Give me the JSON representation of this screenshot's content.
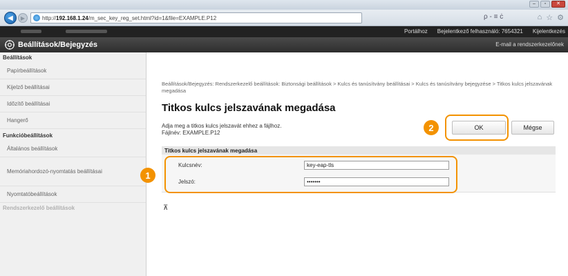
{
  "browser": {
    "address_prefix": "http://",
    "address_host": "192.168.1.24",
    "address_path": "/m_sec_key_reg_set.html?id=1&file=EXAMPLE.P12",
    "search_glyph": "ρ - ≡ ċ",
    "window_controls": [
      "–",
      "▫",
      "✕"
    ]
  },
  "topbar": {
    "links": [
      "Portálhoz",
      "Bejelentkező felhasználó: 7654321",
      "Kijelentkezés"
    ]
  },
  "header": {
    "title": "Beállítások/Bejegyzés",
    "mail_link": "E-mail a rendszerkezelőnek"
  },
  "sidebar": {
    "sections": [
      {
        "heading": "Beállítások",
        "items": [
          "Papírbeállítások",
          "Kijelző beállításai",
          "Időzítő beállításai",
          "Hangerő"
        ]
      },
      {
        "heading": "Funkcióbeállítások",
        "items": [
          "Általános beállítások",
          "Memóriahordozó-nyomtatás beállításai",
          "Nyomtatóbeállítások"
        ]
      },
      {
        "heading": "Rendszerkezelő beállítások",
        "items": []
      }
    ]
  },
  "main": {
    "breadcrumb": "Beállítások/Bejegyzés: Rendszerkezelő beállítások: Biztonsági beállítások > Kulcs és tanúsítvány beállításai > Kulcs és tanúsítvány bejegyzése > Titkos kulcs jelszavának megadása",
    "title": "Titkos kulcs jelszavának megadása",
    "instruction": "Adja meg a titkos kulcs jelszavát ehhez a fájlhoz.",
    "filename": "Fájlnév: EXAMPLE.P12",
    "ok_label": "OK",
    "cancel_label": "Mégse",
    "section_title": "Titkos kulcs jelszavának megadása",
    "key_name_label": "Kulcsnév:",
    "key_name_value": "key-eap-tls",
    "password_label": "Jelszó:",
    "password_value": "eappass",
    "top_glyph": "⊼"
  },
  "callouts": {
    "one": "1",
    "two": "2"
  },
  "colors": {
    "callout": "#f39200",
    "header_bg": "#3a3a3a",
    "topbar_bg": "#222222"
  }
}
